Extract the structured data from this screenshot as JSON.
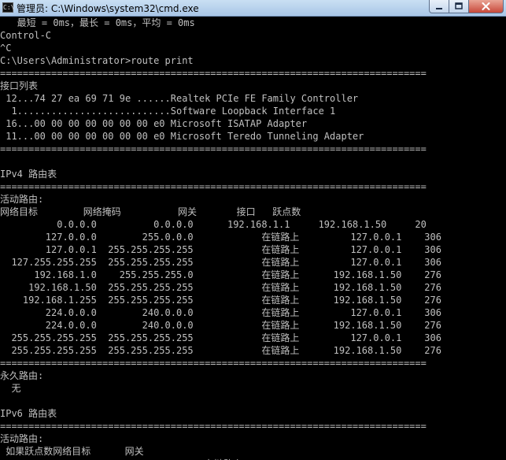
{
  "window": {
    "title": "管理员: C:\\Windows\\system32\\cmd.exe",
    "icon_text": "C:\\"
  },
  "console": {
    "lines": [
      "   最短 = 0ms，最长 = 0ms，平均 = 0ms",
      "Control-C",
      "^C",
      "C:\\Users\\Administrator>route print",
      "===========================================================================",
      "接口列表",
      " 12...74 27 ea 69 71 9e ......Realtek PCIe FE Family Controller",
      "  1...........................Software Loopback Interface 1",
      " 16...00 00 00 00 00 00 00 e0 Microsoft ISATAP Adapter",
      " 11...00 00 00 00 00 00 00 e0 Microsoft Teredo Tunneling Adapter",
      "===========================================================================",
      "",
      "IPv4 路由表",
      "===========================================================================",
      "活动路由:",
      "网络目标        网络掩码          网关       接口   跃点数",
      "          0.0.0.0          0.0.0.0      192.168.1.1     192.168.1.50     20",
      "        127.0.0.0        255.0.0.0            在链路上         127.0.0.1    306",
      "        127.0.0.1  255.255.255.255            在链路上         127.0.0.1    306",
      "  127.255.255.255  255.255.255.255            在链路上         127.0.0.1    306",
      "      192.168.1.0    255.255.255.0            在链路上      192.168.1.50    276",
      "     192.168.1.50  255.255.255.255            在链路上      192.168.1.50    276",
      "    192.168.1.255  255.255.255.255            在链路上      192.168.1.50    276",
      "        224.0.0.0        240.0.0.0            在链路上         127.0.0.1    306",
      "        224.0.0.0        240.0.0.0            在链路上      192.168.1.50    276",
      "  255.255.255.255  255.255.255.255            在链路上         127.0.0.1    306",
      "  255.255.255.255  255.255.255.255            在链路上      192.168.1.50    276",
      "===========================================================================",
      "永久路由:",
      "  无",
      "",
      "IPv6 路由表",
      "===========================================================================",
      "活动路由:",
      " 如果跃点数网络目标      网关",
      "                                    在链路上"
    ]
  }
}
